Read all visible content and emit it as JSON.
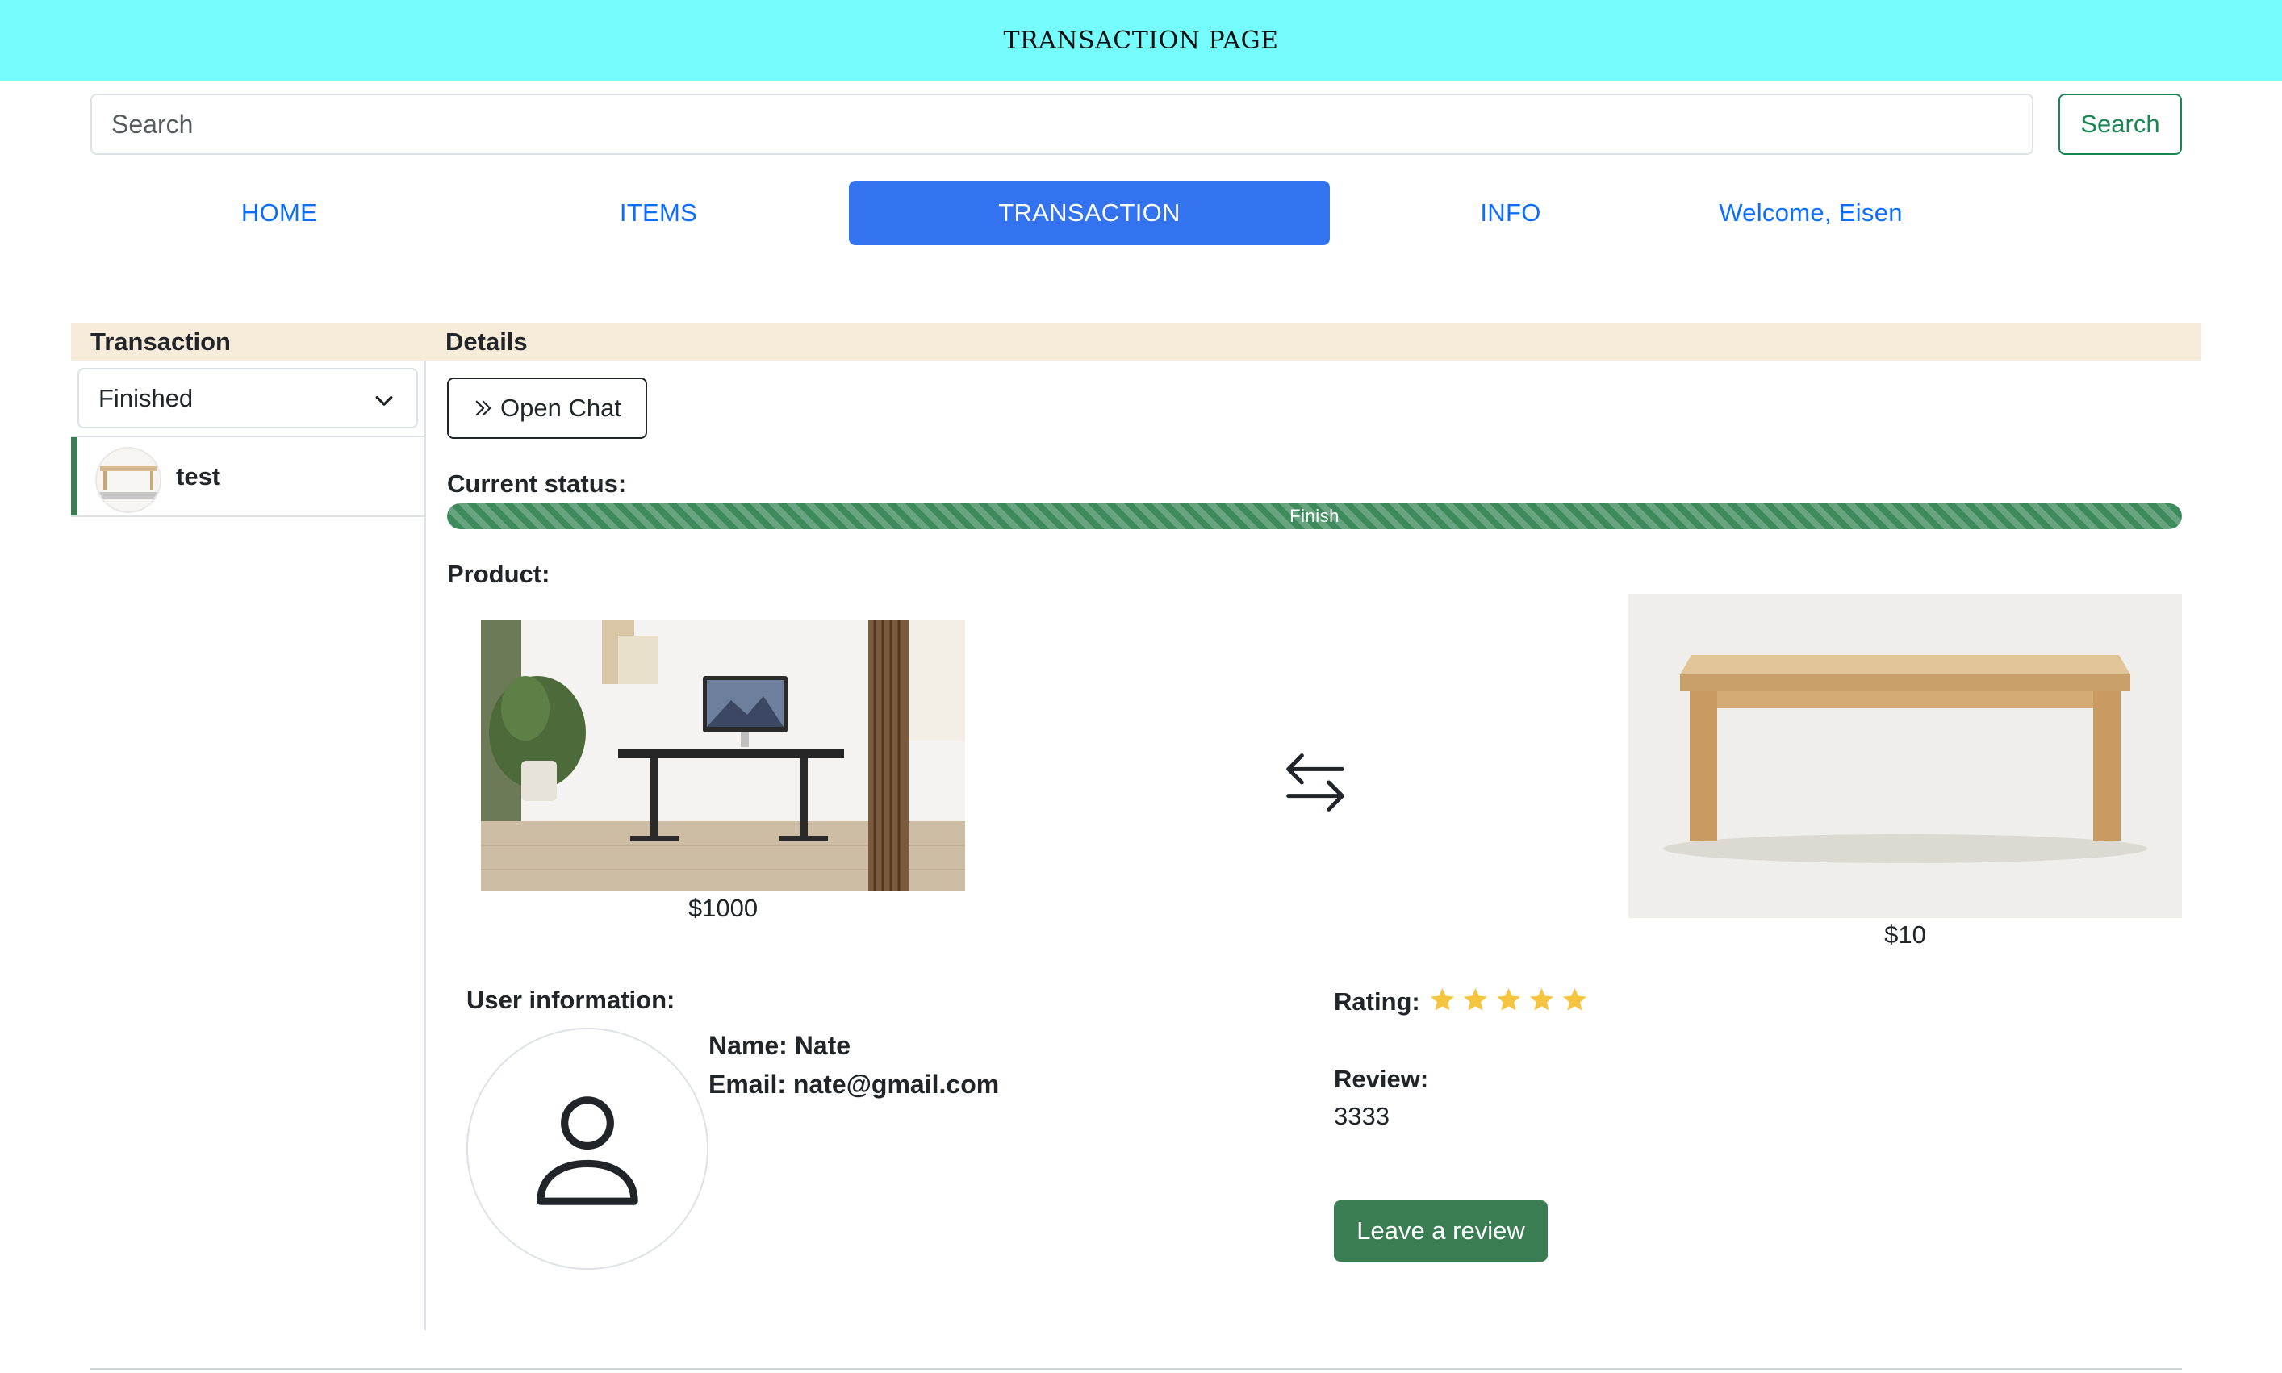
{
  "header": {
    "title": "TRANSACTION PAGE"
  },
  "search": {
    "placeholder": "Search",
    "button_label": "Search"
  },
  "nav": {
    "items": [
      {
        "label": "HOME"
      },
      {
        "label": "ITEMS"
      },
      {
        "label": "TRANSACTION",
        "active": true
      },
      {
        "label": "INFO"
      },
      {
        "label": "Welcome, Eisen"
      }
    ]
  },
  "sidebar": {
    "heading": "Transaction",
    "filter": {
      "selected": "Finished"
    },
    "items": [
      {
        "label": "test",
        "selected": true
      }
    ]
  },
  "details": {
    "heading": "Details",
    "open_chat_label": "Open Chat",
    "status_label": "Current status:",
    "status": {
      "text": "Finish",
      "progress": 1.0
    },
    "product_label": "Product:",
    "products": [
      {
        "price": "$1000",
        "image": "standing-desk-photo"
      },
      {
        "price": "$10",
        "image": "wooden-table-photo"
      }
    ],
    "exchange_icon": "swap-arrows-icon",
    "user": {
      "heading": "User information:",
      "name_line": "Name: Nate",
      "email_line": "Email: nate@gmail.com",
      "avatar_icon": "person-icon"
    },
    "rating": {
      "label": "Rating:",
      "stars": 5,
      "max": 5
    },
    "review": {
      "label": "Review:",
      "text": "3333"
    },
    "leave_review_label": "Leave a review"
  },
  "colors": {
    "header_bg": "#75fcfd",
    "primary": "#3373f0",
    "link": "#0d6efd",
    "success": "#3a7d53",
    "strip_bg": "#f7ebda",
    "star": "#f5c542"
  }
}
